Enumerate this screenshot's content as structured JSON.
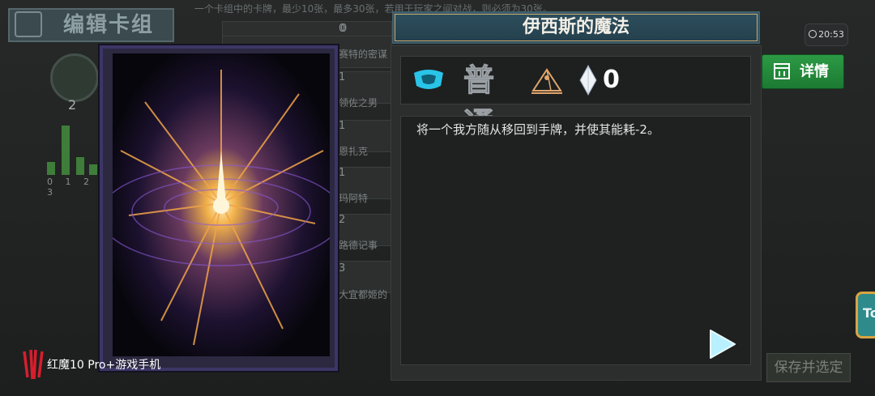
{
  "background": {
    "title": "编辑卡组",
    "rule_text": "一个卡组中的卡牌，最少10张，最多30张，若用于玩家之间对战，则必须为30张。",
    "mana_count": "2",
    "curve_labels": "0 1 2 3",
    "curve_values": [
      0.25,
      0.95,
      0.35,
      0.2
    ],
    "list": [
      {
        "cost": "0",
        "name": ""
      },
      {
        "cost": "0",
        "name": "赛特的密谋"
      },
      {
        "cost": "1",
        "name": "领佐之男"
      },
      {
        "cost": "1",
        "name": "恩扎克"
      },
      {
        "cost": "1",
        "name": "玛阿特"
      },
      {
        "cost": "2",
        "name": "路德记事"
      },
      {
        "cost": "3",
        "name": "大宜都姬的"
      }
    ],
    "save_label": "保存并选定",
    "side_button_label": "To"
  },
  "status": {
    "time": "20:53"
  },
  "card": {
    "title": "伊西斯的魔法",
    "rarity": "普通",
    "cost": "0",
    "description": "将一个我方随从移回到手牌，并使其能耗-2。",
    "faction_icon": "faction-badge-icon",
    "type_icon": "pyramid-spell-icon",
    "cost_icon": "crystal-icon"
  },
  "detail_button": {
    "label": "详情",
    "icon": "card-page-icon"
  },
  "watermark": {
    "text": "红魔10 Pro+游戏手机"
  },
  "colors": {
    "title_bar": "#2e4f5e",
    "detail_button": "#2c9a45",
    "faction_accent": "#29c4e8"
  }
}
